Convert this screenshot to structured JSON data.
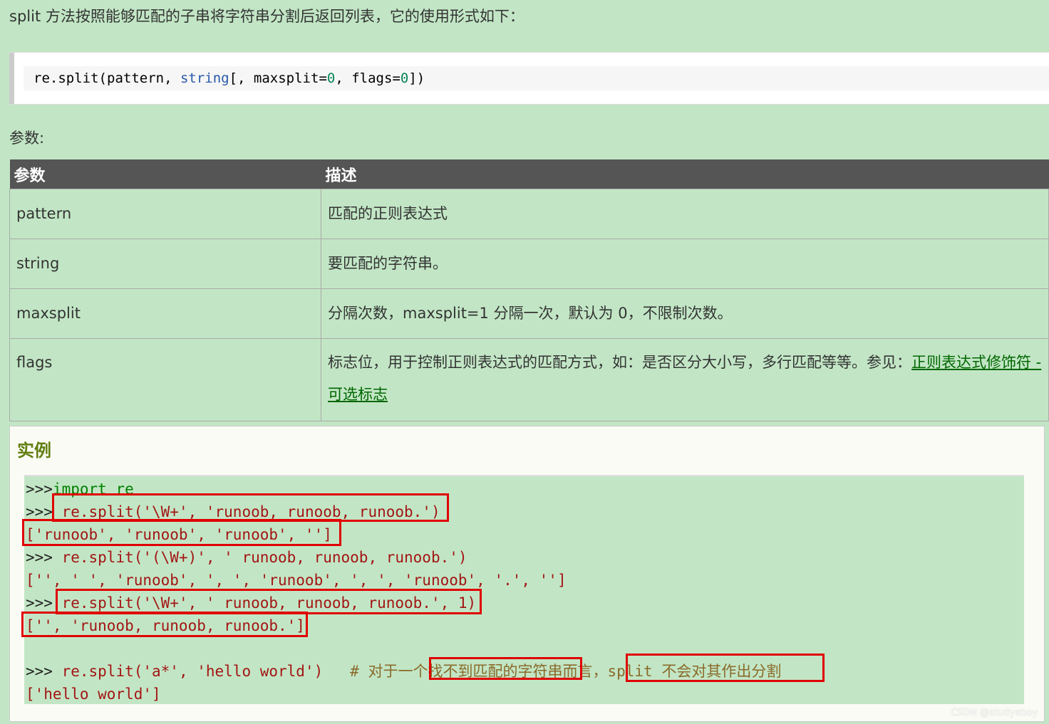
{
  "intro_text": "split 方法按照能够匹配的子串将字符串分割后返回列表，它的使用形式如下：",
  "syntax": {
    "prefix": "re",
    "dot": ".",
    "func": "split",
    "open": "(",
    "arg1": "pattern",
    "comma1": ", ",
    "arg2": "string",
    "rest1": "[, maxsplit",
    "eq1": "=",
    "val1": "0",
    "rest2": ", flags",
    "eq2": "=",
    "val2": "0",
    "close": "])"
  },
  "params_label": "参数:",
  "table": {
    "headers": [
      "参数",
      "描述"
    ],
    "rows": [
      {
        "name": "pattern",
        "desc": "匹配的正则表达式"
      },
      {
        "name": "string",
        "desc": "要匹配的字符串。"
      },
      {
        "name": "maxsplit",
        "desc": "分隔次数，maxsplit=1 分隔一次，默认为 0，不限制次数。"
      },
      {
        "name": "flags",
        "desc": "标志位，用于控制正则表达式的匹配方式，如：是否区分大小写，多行匹配等等。参见：",
        "link": "正则表达式修饰符 - 可选标志"
      }
    ]
  },
  "example": {
    "title": "实例",
    "lines": [
      {
        "prompt": ">>>",
        "code": "import re"
      },
      {
        "prompt": ">>>",
        "code": " re.split('\\W+', 'runoob, runoob, runoob.')"
      },
      {
        "prompt": "",
        "code": "['runoob', 'runoob', 'runoob', '']"
      },
      {
        "prompt": ">>>",
        "code": " re.split('(\\W+)', ' runoob, runoob, runoob.')"
      },
      {
        "prompt": "",
        "code": "['', ' ', 'runoob', ', ', 'runoob', ', ', 'runoob', '.', '']"
      },
      {
        "prompt": ">>>",
        "code": " re.split('\\W+', ' runoob, runoob, runoob.', 1)"
      },
      {
        "prompt": "",
        "code": "['', 'runoob, runoob, runoob.']"
      },
      {
        "prompt": "",
        "code": ""
      },
      {
        "prompt": ">>>",
        "code": " re.split('a*', 'hello world')   ",
        "comment": "# 对于一个找不到匹配的字符串而言，split 不会对其作出分割"
      },
      {
        "prompt": "",
        "code": "['hello world']"
      }
    ]
  },
  "watermark": "CSDN @studyeboy",
  "colors": {
    "page_bg": "#c2e6c5",
    "header_bg": "#555555",
    "highlight": "#e00000",
    "example_title": "#617f10"
  }
}
